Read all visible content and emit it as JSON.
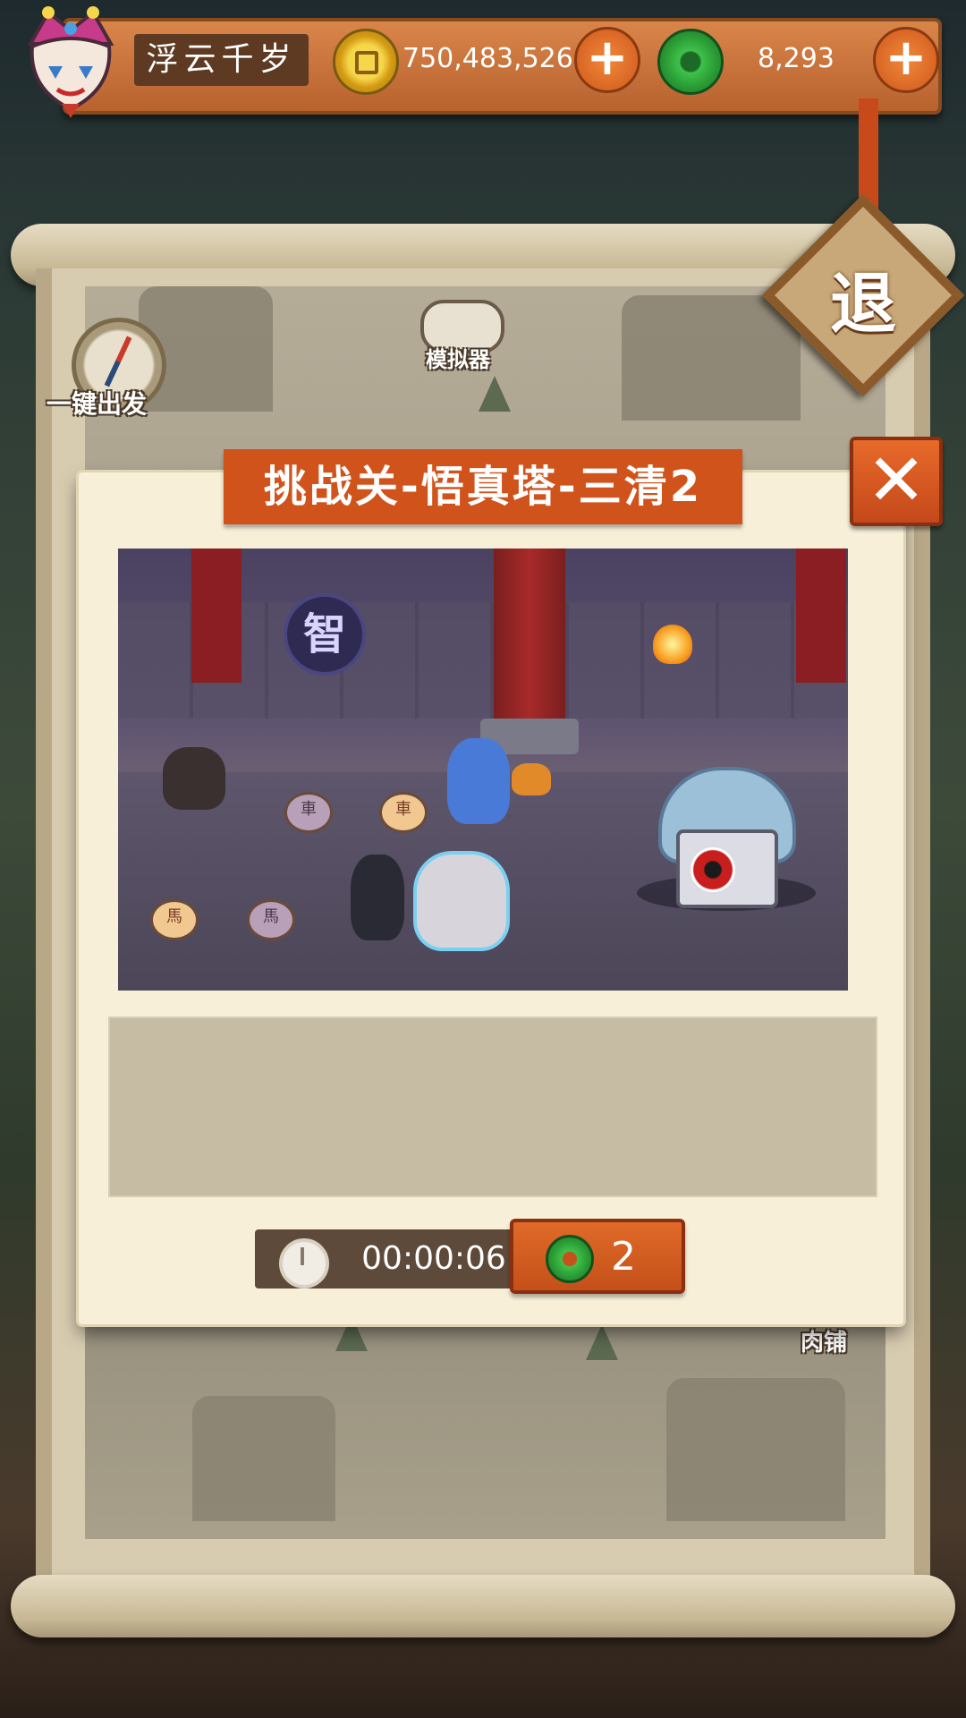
{
  "player": {
    "name": "浮云千岁"
  },
  "currencies": {
    "gold": "750,483,526",
    "jade": "8,293"
  },
  "map": {
    "auto_depart_label": "一键出发",
    "emulator_label": "模拟器",
    "exit_label": "退",
    "shop_label": "肉铺"
  },
  "dialog": {
    "title": "挑战关-悟真塔-三清2",
    "close_label": "✕",
    "battle_sign": "智",
    "piece_label_che": "車",
    "piece_label_ma": "馬",
    "timer": "00:00:06",
    "cost": "2"
  },
  "colors": {
    "accent": "#d0531c",
    "panel": "#f7efd8",
    "jade": "#2a9a34",
    "gold": "#f6d64a"
  }
}
